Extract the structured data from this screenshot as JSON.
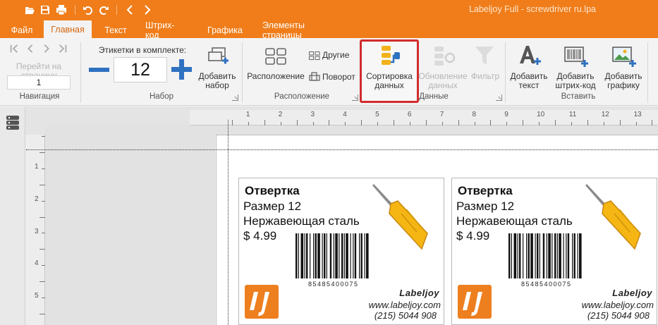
{
  "window": {
    "title": "Labeljoy Full - screwdriver ru.lpa",
    "accent_color": "#f07d1a"
  },
  "quick_access": [
    {
      "icon": "folder-open-icon"
    },
    {
      "icon": "save-icon"
    },
    {
      "icon": "print-icon"
    },
    {
      "icon": "undo-icon"
    },
    {
      "icon": "redo-icon"
    },
    {
      "icon": "back-icon"
    },
    {
      "icon": "forward-icon"
    }
  ],
  "tabs": [
    {
      "label": "Файл"
    },
    {
      "label": "Главная",
      "active": true
    },
    {
      "label": "Текст"
    },
    {
      "label": "Штрих-код"
    },
    {
      "label": "Графика"
    },
    {
      "label": "Элементы страницы"
    }
  ],
  "ribbon": {
    "navigation": {
      "goto_label": "Перейти на страницу",
      "page_value": "1",
      "group_label": "Навигация"
    },
    "set": {
      "count_label": "Этикетки в комплекте:",
      "count_value": "12",
      "add_set_label": "Добавить набор",
      "group_label": "Набор"
    },
    "layout": {
      "layout_label": "Расположение",
      "other_label": "Другие",
      "rotate_label": "Поворот",
      "group_label": "Расположение"
    },
    "data": {
      "sort_label": "Сортировка данных",
      "refresh_label": "Обновление данных",
      "filter_label": "Фильтр",
      "group_label": "Данные"
    },
    "insert": {
      "add_text_label": "Добавить текст",
      "add_barcode_label": "Добавить штрих-код",
      "add_graphic_label": "Добавить графику",
      "group_label": "Вставить"
    }
  },
  "ruler": {
    "horizontal": [
      "1",
      "2",
      "3",
      "4",
      "5",
      "6",
      "7",
      "8",
      "9",
      "10",
      "11",
      "12",
      "13"
    ],
    "vertical": [
      "1",
      "2",
      "3",
      "4",
      "5"
    ]
  },
  "labels": [
    {
      "title": "Отвертка",
      "size": "Размер 12",
      "material": "Нержавеющая сталь",
      "price": "$ 4.99",
      "barcode": "85485400075",
      "brand": "Labeljoy",
      "website": "www.labeljoy.com",
      "phone": "(215) 5044 908"
    },
    {
      "title": "Отвертка",
      "size": "Размер 12",
      "material": "Нержавеющая сталь",
      "price": "$ 4.99",
      "barcode": "85485400075",
      "brand": "Labeljoy",
      "website": "www.labeljoy.com",
      "phone": "(215) 5044 908"
    }
  ]
}
